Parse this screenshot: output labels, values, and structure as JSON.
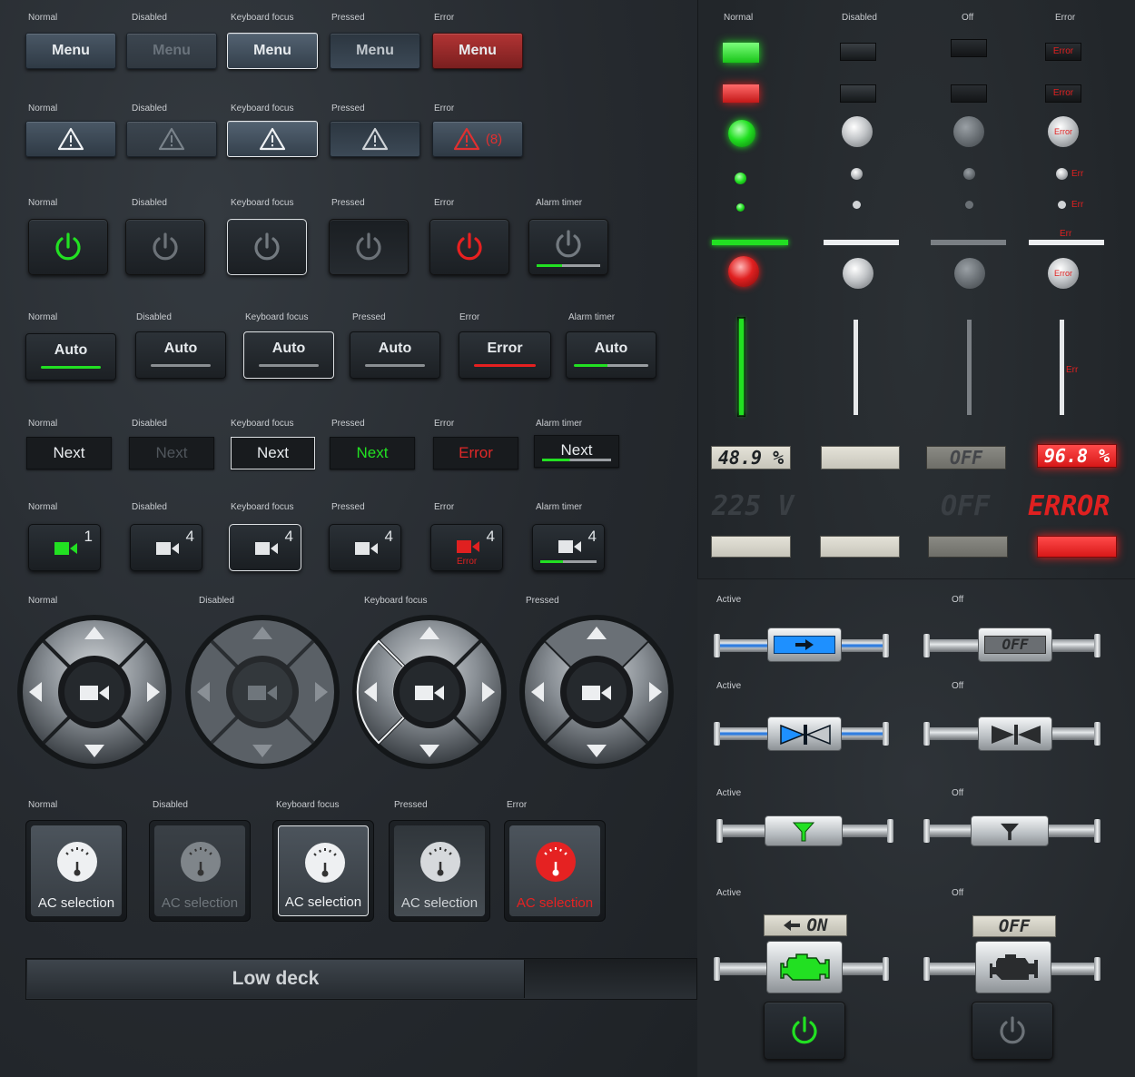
{
  "row1": {
    "labels": [
      "Normal",
      "Disabled",
      "Keyboard focus",
      "Pressed",
      "Error"
    ],
    "button_label": "Menu"
  },
  "row2": {
    "labels": [
      "Normal",
      "Disabled",
      "Keyboard focus",
      "Pressed",
      "Error"
    ],
    "error_count": "(8)"
  },
  "row3": {
    "labels": [
      "Normal",
      "Disabled",
      "Keyboard focus",
      "Pressed",
      "Error",
      "Alarm timer"
    ]
  },
  "row4": {
    "labels": [
      "Normal",
      "Disabled",
      "Keyboard focus",
      "Pressed",
      "Error",
      "Alarm timer"
    ],
    "buttons": [
      "Auto",
      "Auto",
      "Auto",
      "Auto",
      "Error",
      "Auto"
    ]
  },
  "row5": {
    "labels": [
      "Normal",
      "Disabled",
      "Keyboard focus",
      "Pressed",
      "Error",
      "Alarm timer"
    ],
    "buttons": [
      "Next",
      "Next",
      "Next",
      "Next",
      "Error",
      "Next"
    ]
  },
  "row6": {
    "labels": [
      "Normal",
      "Disabled",
      "Keyboard focus",
      "Pressed",
      "Error",
      "Alarm timer"
    ],
    "counts": [
      "1",
      "4",
      "4",
      "4",
      "4",
      "4"
    ],
    "error_text": "Error"
  },
  "row7": {
    "labels": [
      "Normal",
      "Disabled",
      "Keyboard focus",
      "Pressed"
    ]
  },
  "row8": {
    "labels": [
      "Normal",
      "Disabled",
      "Keyboard focus",
      "Pressed",
      "Error"
    ],
    "button_label": "AC selection"
  },
  "footer": {
    "title": "Low deck"
  },
  "status": {
    "labels": [
      "Normal",
      "Disabled",
      "Off",
      "Error"
    ],
    "error_short": "Err",
    "error_word": "Error",
    "readout_normal": "48.9 %",
    "readout_off": "OFF",
    "readout_error": "96.8 %",
    "voltage": "225 V",
    "voltage_off": "OFF",
    "voltage_error": "ERROR"
  },
  "pipes": {
    "active_label": "Active",
    "off_label": "Off",
    "pump_off": "OFF",
    "engine_on": "ON",
    "engine_off": "OFF"
  },
  "colors": {
    "green": "#20e020",
    "red": "#e02020",
    "blue": "#2f7de0"
  }
}
